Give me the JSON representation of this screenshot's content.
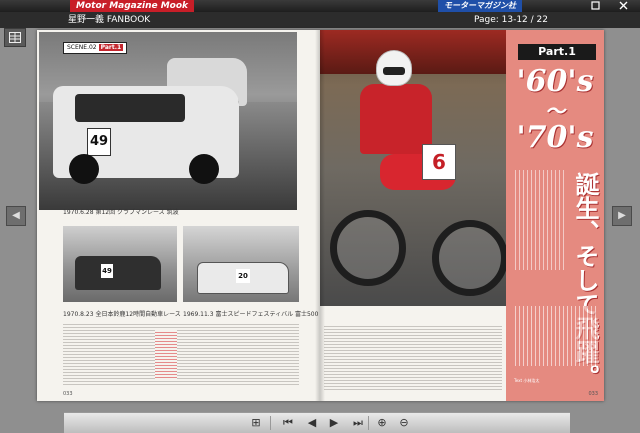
{
  "header": {
    "logo_text": "Motor Magazine Mook",
    "publisher": "モーターマガジン社",
    "maximize_icon": "maximize-icon",
    "close_icon": "close-icon"
  },
  "titlebar": {
    "book_title": "星野一義 FANBOOK",
    "page_info": "Page:  13-12 / 22"
  },
  "left_page": {
    "scene_tag": "SCENE.02",
    "scene_part": "Part.1",
    "main_car_number": "49",
    "main_caption": "1970.6.28  第12回 クラブマンレース 筑波",
    "small1_caption": "1970.8.23  全日本鈴鹿12時間自動車レース",
    "small2_caption": "1969.11.3  富士スピードフェスティバル 富士500 キロレース",
    "small1_car_number": "49",
    "small2_car_number": "20",
    "page_number": "033"
  },
  "right_page": {
    "part_label": "Part.1",
    "era_start": "'60's",
    "era_tilde": "〜",
    "era_end": "'70's",
    "title_vertical": "誕生、そして飛躍。",
    "bike_number": "6",
    "byline": "Text  小林浩太",
    "page_number": "033"
  },
  "toolbar": {
    "thumbs": "⊞",
    "first": "⏮",
    "prev": "◀",
    "next": "▶",
    "last": "⏭",
    "zoom_in": "⊕",
    "zoom_out": "⊖"
  },
  "nav": {
    "left": "◀",
    "right": "▶"
  }
}
